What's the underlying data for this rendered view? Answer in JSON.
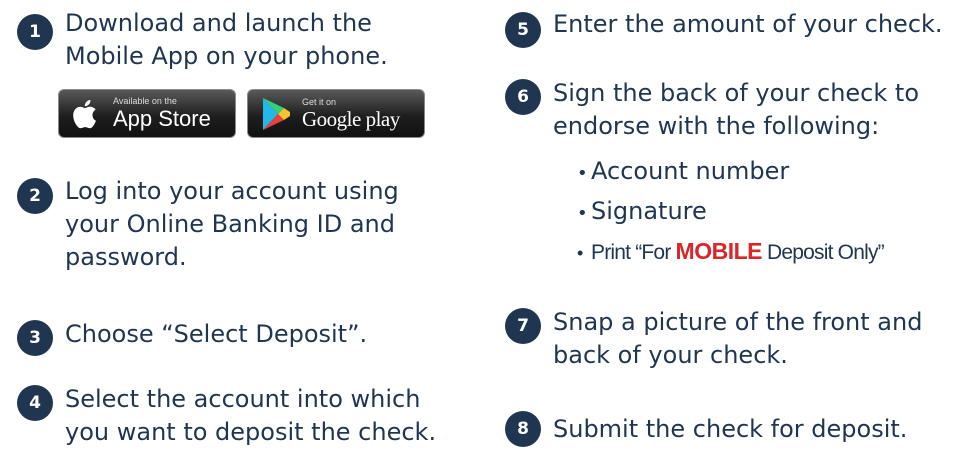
{
  "steps": [
    {
      "number": "1",
      "text": "Download and launch the\nMobile App on your phone."
    },
    {
      "number": "2",
      "text": "Log into your account using\nyour Online Banking ID and\npassword."
    },
    {
      "number": "3",
      "text": "Choose “Select Deposit”."
    },
    {
      "number": "4",
      "text": "Select the account into which\nyou want to deposit the check."
    },
    {
      "number": "5",
      "text": "Enter the amount of your check."
    },
    {
      "number": "6",
      "text": "Sign the back of your check to\nendorse with the following:"
    },
    {
      "number": "7",
      "text": "Snap a picture of the front and\nback of your check."
    },
    {
      "number": "8",
      "text": "Submit the check for deposit."
    }
  ],
  "endorsement": {
    "bullet": "•",
    "items": [
      "Account number",
      "Signature"
    ],
    "print_prefix": "Print “For ",
    "print_highlight": "MOBILE",
    "print_suffix": " Deposit Only”"
  },
  "badges": {
    "app_store": {
      "small": "Available on the",
      "big": "App Store",
      "icon": "apple-icon"
    },
    "google_play": {
      "small": "Get it on",
      "big": "Google play",
      "icon": "play-triangle-icon"
    }
  },
  "colors": {
    "navy": "#1f3550",
    "red": "#d8262a"
  }
}
